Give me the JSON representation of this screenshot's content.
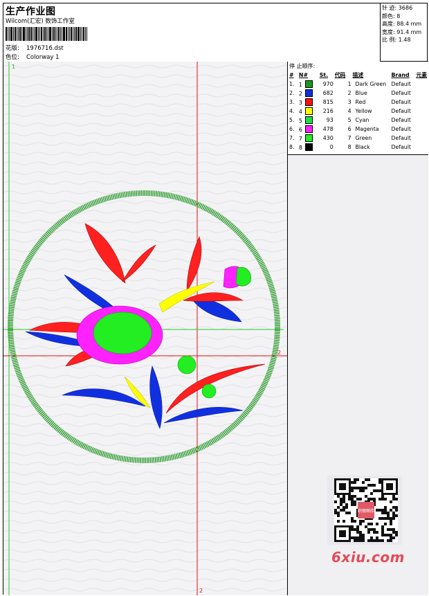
{
  "header": {
    "title": "生产作业图",
    "company": "Wilcom(汇宏) 数饰工作室",
    "design_label": "花版:",
    "design_value": "1976716.dst",
    "colorway_label": "色位:",
    "colorway_value": "Colorway 1"
  },
  "info": {
    "stitches_label": "针 迹:",
    "stitches_value": "3686",
    "colors_label": "颜色:",
    "colors_value": "8",
    "height_label": "高度:",
    "height_value": "88.4 mm",
    "width_label": "宽度:",
    "width_value": "91.4 mm",
    "scale_label": "比 例:",
    "scale_value": "1.48"
  },
  "canvas": {
    "marker_top": "1",
    "marker_bottom": "2",
    "marker_right": "2"
  },
  "stop_sequence": {
    "title": "停 止顺序:",
    "headers": [
      "#",
      "N#",
      "St.",
      "代码",
      "描述",
      "Brand",
      "元素"
    ],
    "rows": [
      {
        "idx": "1.",
        "n": "1",
        "color": "#1a9a1a",
        "st": "970",
        "code": "1",
        "desc": "Dark Green",
        "brand": "Default"
      },
      {
        "idx": "2.",
        "n": "2",
        "color": "#1030e0",
        "st": "682",
        "code": "2",
        "desc": "Blue",
        "brand": "Default"
      },
      {
        "idx": "3.",
        "n": "3",
        "color": "#ff1010",
        "st": "815",
        "code": "3",
        "desc": "Red",
        "brand": "Default"
      },
      {
        "idx": "4.",
        "n": "4",
        "color": "#ffff00",
        "st": "216",
        "code": "4",
        "desc": "Yellow",
        "brand": "Default"
      },
      {
        "idx": "5.",
        "n": "5",
        "color": "#22dd44",
        "st": "93",
        "code": "5",
        "desc": "Cyan",
        "brand": "Default"
      },
      {
        "idx": "6.",
        "n": "6",
        "color": "#ff22ff",
        "st": "478",
        "code": "6",
        "desc": "Magenta",
        "brand": "Default"
      },
      {
        "idx": "7.",
        "n": "7",
        "color": "#22ee22",
        "st": "430",
        "code": "7",
        "desc": "Green",
        "brand": "Default"
      },
      {
        "idx": "8.",
        "n": "8",
        "color": "#000000",
        "st": "0",
        "code": "8",
        "desc": "Black",
        "brand": "Default"
      }
    ]
  },
  "watermark": {
    "qr_badge": "织丽图库",
    "site": "6xiu.com"
  }
}
